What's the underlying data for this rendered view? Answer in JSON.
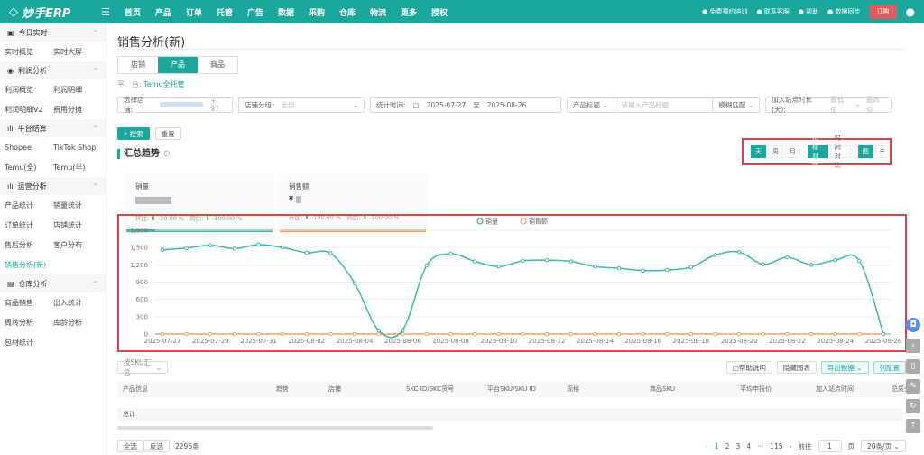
{
  "app": {
    "logo": "妙手ERP",
    "nav": [
      "首页",
      "产品",
      "订单",
      "托管",
      "广告",
      "数据",
      "采购",
      "仓库",
      "物流",
      "更多",
      "授权"
    ],
    "right_links": [
      "免费预约培训",
      "联系客服",
      "帮助",
      "数据同步"
    ],
    "order_button": "订购"
  },
  "sidebar": [
    {
      "group": "今日实时",
      "items": [
        "实时概览",
        "实时大屏"
      ]
    },
    {
      "group": "利润分析",
      "items": [
        "利润概览",
        "利润明细",
        "利润明细V2",
        "费用分摊"
      ]
    },
    {
      "group": "平台结算",
      "items": [
        "Shopee",
        "TikTok Shop",
        "Temu(全)",
        "Temu(半)"
      ]
    },
    {
      "group": "运营分析",
      "items": [
        "产品统计",
        "销量统计",
        "订单统计",
        "店铺统计",
        "售后分析",
        "客户分布",
        "销售分析(新)"
      ]
    },
    {
      "group": "仓库分析",
      "items": [
        "商品销售",
        "出入统计",
        "周转分析",
        "库龄分析",
        "包材统计"
      ]
    }
  ],
  "page": {
    "title": "销售分析(新)",
    "tabs": [
      "店铺",
      "产品",
      "商品"
    ],
    "active_tab": "产品",
    "platform_label": "平　台:",
    "platform_value": "Temu全托管",
    "filters": {
      "shop_label": "选择店铺:",
      "shop_extra": "+ 97",
      "group_label": "店铺分组:",
      "group_value": "全部",
      "time_label": "统计时间:",
      "date_from": "2025-07-27",
      "date_to_sep": "至",
      "date_to": "2025-08-26",
      "title_select": "产品标题",
      "title_placeholder": "请输入产品标题",
      "match": "模糊匹配",
      "join_label": "加入站点时长(天):",
      "min_ph": "最低值",
      "dash": "-",
      "max_ph": "最高值"
    },
    "search_btn": "搜索",
    "reset_btn": "重置",
    "section": "汇总趋势",
    "toggles": [
      "天",
      "周",
      "月",
      "指标对比",
      "时间对比",
      "图",
      "☰"
    ],
    "cards": [
      {
        "label": "销量",
        "value_prefix": "",
        "mom_label": "环比:",
        "mom": "-10.00 %",
        "yoy_label": "同比:",
        "yoy": "-100.00 %"
      },
      {
        "label": "销售额",
        "value_prefix": "¥",
        "mom_label": "环比:",
        "mom": "-100.00 %",
        "yoy_label": "同比:",
        "yoy": "-100.00 %"
      }
    ],
    "table": {
      "group_select": "按SKU汇总",
      "actions": [
        "帮助说明",
        "隐藏图表",
        "导出数据",
        "列配置"
      ],
      "headers": [
        "产品信息",
        "趋势",
        "店铺",
        "SKC ID/SKC货号",
        "平台SKU/SKU ID",
        "规格",
        "商品SKU",
        "平均申报价",
        "加入站点时间",
        "总质分"
      ],
      "total": "总计"
    },
    "footer": {
      "select_all": "全选",
      "invert": "反选",
      "count": "2296条",
      "pages": [
        "1",
        "2",
        "3",
        "4",
        "···",
        "115"
      ],
      "goto": "前往",
      "page_input": "1",
      "page_unit": "页",
      "page_size": "20条/页"
    }
  },
  "colors": {
    "brand": "#1ba89c",
    "sales": "#3dbaa5",
    "amount": "#f0a35e",
    "highlight": "#d9464a"
  },
  "chart_data": {
    "type": "line",
    "x": [
      "2025-07-27",
      "2025-07-28",
      "2025-07-29",
      "2025-07-30",
      "2025-07-31",
      "2025-08-01",
      "2025-08-02",
      "2025-08-03",
      "2025-08-04",
      "2025-08-05",
      "2025-08-06",
      "2025-08-07",
      "2025-08-08",
      "2025-08-09",
      "2025-08-10",
      "2025-08-11",
      "2025-08-12",
      "2025-08-13",
      "2025-08-14",
      "2025-08-15",
      "2025-08-16",
      "2025-08-17",
      "2025-08-18",
      "2025-08-19",
      "2025-08-20",
      "2025-08-21",
      "2025-08-22",
      "2025-08-23",
      "2025-08-24",
      "2025-08-25",
      "2025-08-26"
    ],
    "series": [
      {
        "name": "销量",
        "color": "#3dbaa5",
        "values": [
          1460,
          1490,
          1540,
          1480,
          1550,
          1500,
          1410,
          1400,
          880,
          60,
          70,
          1190,
          1390,
          1260,
          1170,
          1270,
          1280,
          1260,
          1170,
          1140,
          1100,
          1110,
          1160,
          1370,
          1420,
          1210,
          1330,
          1200,
          1280,
          1270,
          0
        ]
      },
      {
        "name": "销售额",
        "color": "#f0a35e",
        "values": [
          0,
          0,
          0,
          0,
          0,
          0,
          0,
          0,
          0,
          0,
          0,
          0,
          0,
          0,
          0,
          0,
          0,
          0,
          0,
          0,
          0,
          0,
          0,
          0,
          0,
          0,
          0,
          0,
          0,
          0,
          0
        ]
      }
    ],
    "yticks": [
      "0",
      "300",
      "600",
      "900",
      "1,200",
      "1,500",
      "1,800"
    ],
    "ylim": [
      0,
      1800
    ],
    "legend": "top-center",
    "grid": true
  }
}
